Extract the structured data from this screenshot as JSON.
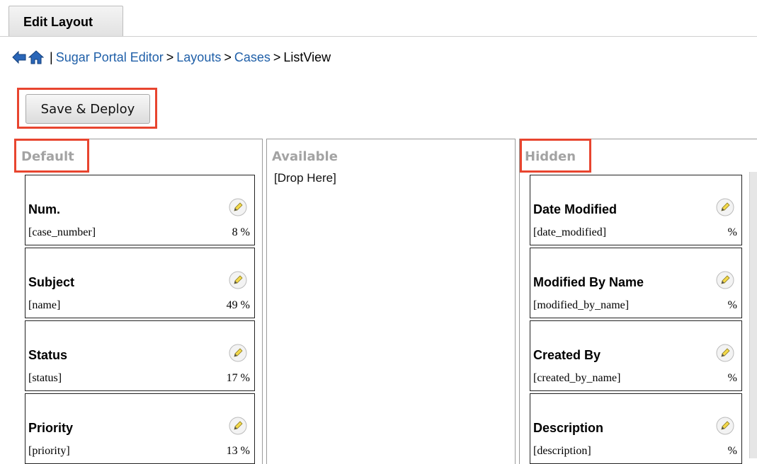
{
  "tab": {
    "label": "Edit Layout"
  },
  "breadcrumb": {
    "items": [
      {
        "label": "Sugar Portal Editor"
      },
      {
        "label": "Layouts"
      },
      {
        "label": "Cases"
      },
      {
        "label": "ListView"
      }
    ],
    "separator": ">",
    "pipe": "|"
  },
  "toolbar": {
    "save_label": "Save & Deploy"
  },
  "panels": {
    "default": {
      "title": "Default",
      "fields": [
        {
          "label": "Num.",
          "field": "[case_number]",
          "width": "8 %"
        },
        {
          "label": "Subject",
          "field": "[name]",
          "width": "49 %"
        },
        {
          "label": "Status",
          "field": "[status]",
          "width": "17 %"
        },
        {
          "label": "Priority",
          "field": "[priority]",
          "width": "13 %"
        }
      ]
    },
    "available": {
      "title": "Available",
      "drop_text": "[Drop Here]"
    },
    "hidden": {
      "title": "Hidden",
      "fields": [
        {
          "label": "Date Modified",
          "field": "[date_modified]",
          "width": "%"
        },
        {
          "label": "Modified By Name",
          "field": "[modified_by_name]",
          "width": "%"
        },
        {
          "label": "Created By",
          "field": "[created_by_name]",
          "width": "%"
        },
        {
          "label": "Description",
          "field": "[description]",
          "width": "%"
        }
      ]
    }
  },
  "colors": {
    "link": "#1f5fa8",
    "highlight": "#e8452f",
    "panel_title": "#a3a3a3"
  }
}
